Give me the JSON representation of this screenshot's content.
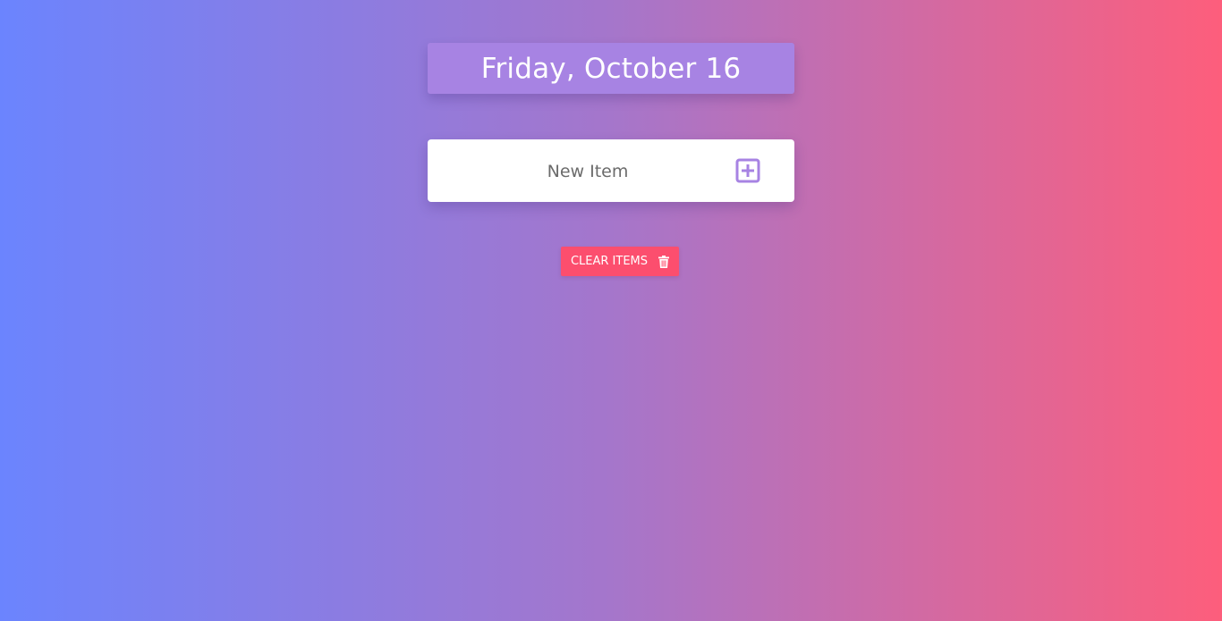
{
  "header": {
    "date": "Friday, October 16"
  },
  "new_item": {
    "placeholder": "New Item",
    "value": "",
    "add_icon": "plus-square-icon"
  },
  "clear_button": {
    "label": "CLEAR ITEMS",
    "icon": "trash-icon"
  },
  "colors": {
    "gradient_start": "#6b84fe",
    "gradient_end": "#fd5e7c",
    "header_bg": "#a783e3",
    "accent": "#a783e3",
    "clear_button_bg": "#fc4e6e"
  }
}
